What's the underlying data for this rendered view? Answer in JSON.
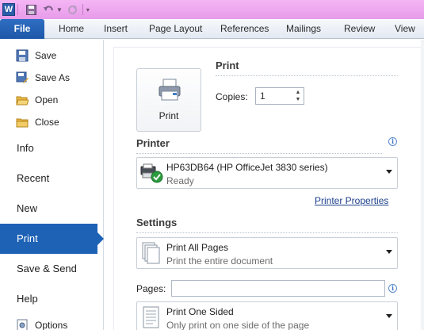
{
  "app": {
    "logo_letter": "W"
  },
  "tabs": [
    "File",
    "Home",
    "Insert",
    "Page Layout",
    "References",
    "Mailings",
    "Review",
    "View"
  ],
  "nav": {
    "small_items": [
      {
        "label": "Save",
        "icon": "save-icon"
      },
      {
        "label": "Save As",
        "icon": "save-as-icon"
      },
      {
        "label": "Open",
        "icon": "open-folder-icon"
      },
      {
        "label": "Close",
        "icon": "close-folder-icon"
      }
    ],
    "big_items": [
      "Info",
      "Recent",
      "New",
      "Print",
      "Save & Send",
      "Help"
    ],
    "active": "Print",
    "bottom_item": {
      "label": "Options",
      "icon": "options-icon"
    }
  },
  "print": {
    "section_title": "Print",
    "button_label": "Print",
    "copies_label": "Copies:",
    "copies_value": "1"
  },
  "printer": {
    "section_title": "Printer",
    "name": "HP63DB64 (HP OfficeJet 3830 series)",
    "status": "Ready",
    "properties_link": "Printer Properties"
  },
  "settings": {
    "section_title": "Settings",
    "range_main": "Print All Pages",
    "range_sub": "Print the entire document",
    "pages_label": "Pages:",
    "pages_value": "",
    "sided_main": "Print One Sided",
    "sided_sub": "Only print on one side of the page"
  },
  "colors": {
    "titlebar": "#e79be9",
    "file_tab": "#1d57a8",
    "active_nav": "#1e62b6",
    "link": "#1c3f8a"
  }
}
